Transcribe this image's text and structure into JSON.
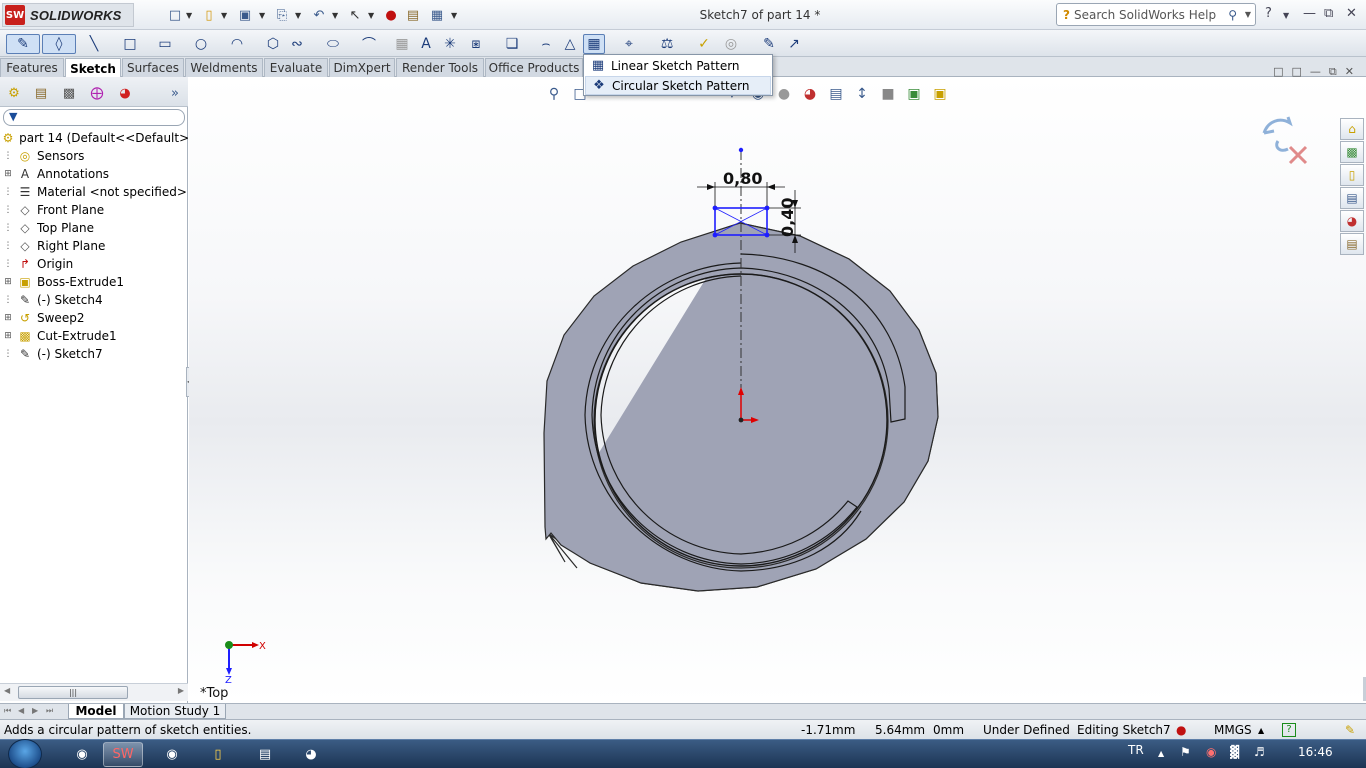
{
  "app": {
    "brand": "SOLIDWORKS",
    "window_title": "Sketch7 of part 14 *",
    "help_placeholder": "Search SolidWorks Help"
  },
  "tabs": [
    "Features",
    "Sketch",
    "Surfaces",
    "Weldments",
    "Evaluate",
    "DimXpert",
    "Render Tools",
    "Office Products"
  ],
  "active_tab": "Sketch",
  "flyout": {
    "items": [
      "Linear Sketch Pattern",
      "Circular Sketch Pattern"
    ],
    "highlighted": "Circular Sketch Pattern"
  },
  "tree": {
    "filter_icon": "funnel-icon",
    "root": "part 14  (Default<<Default>_Di",
    "items": [
      {
        "label": "Sensors",
        "icon": "sensor-icon",
        "expandable": false
      },
      {
        "label": "Annotations",
        "icon": "annotation-icon",
        "expandable": true
      },
      {
        "label": "Material <not specified>",
        "icon": "material-icon",
        "expandable": false
      },
      {
        "label": "Front Plane",
        "icon": "plane-icon",
        "expandable": false
      },
      {
        "label": "Top Plane",
        "icon": "plane-icon",
        "expandable": false
      },
      {
        "label": "Right Plane",
        "icon": "plane-icon",
        "expandable": false
      },
      {
        "label": "Origin",
        "icon": "origin-icon",
        "expandable": false
      },
      {
        "label": "Boss-Extrude1",
        "icon": "extrude-icon",
        "expandable": true
      },
      {
        "label": "(-) Sketch4",
        "icon": "sketch-icon",
        "expandable": false
      },
      {
        "label": "Sweep2",
        "icon": "sweep-icon",
        "expandable": true
      },
      {
        "label": "Cut-Extrude1",
        "icon": "cut-icon",
        "expandable": true
      },
      {
        "label": "(-) Sketch7",
        "icon": "sketch-icon",
        "expandable": false
      }
    ]
  },
  "viewport": {
    "dimensions": {
      "width": "0,80",
      "height": "0,40"
    },
    "view_name": "*Top",
    "triad": {
      "x": "X",
      "z": "Z"
    }
  },
  "bottom_tabs": [
    "Model",
    "Motion Study 1"
  ],
  "status": {
    "message": "Adds a circular pattern of sketch entities.",
    "x": "-1.71mm",
    "y": "5.64mm",
    "z": "0mm",
    "state": "Under Defined",
    "editing": "Editing Sketch7",
    "units": "MMGS"
  },
  "taskbar": {
    "lang": "TR",
    "time": "16:46"
  },
  "colors": {
    "accent": "#1a4c99",
    "part": "#9fa3b5",
    "sketch": "#1e1eff",
    "origin": "#e00000"
  }
}
